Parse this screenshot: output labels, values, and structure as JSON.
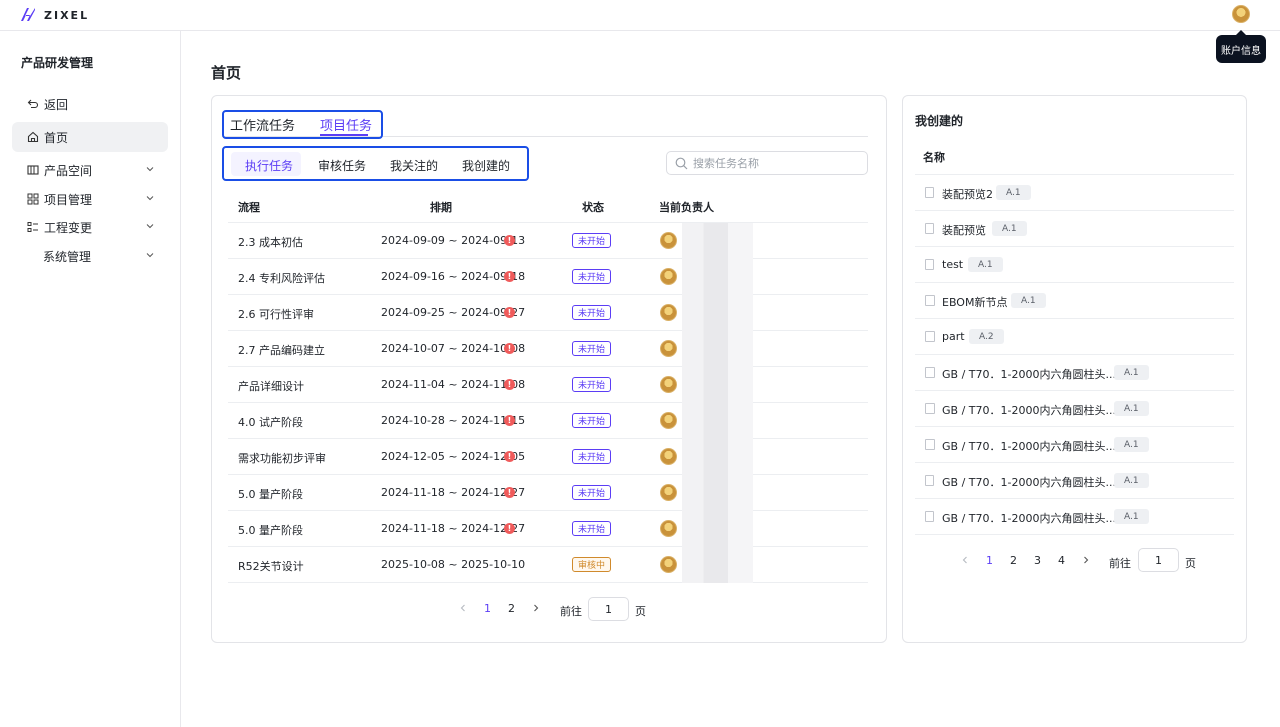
{
  "brand": {
    "name": "ZIXEL"
  },
  "account": {
    "tooltip": "账户信息"
  },
  "sidebar": {
    "title": "产品研发管理",
    "items": [
      {
        "label": "返回",
        "icon": "back-icon"
      },
      {
        "label": "首页",
        "icon": "home-icon",
        "active": true
      },
      {
        "label": "产品空间",
        "icon": "product-space-icon"
      },
      {
        "label": "项目管理",
        "icon": "project-grid-icon"
      },
      {
        "label": "工程变更",
        "icon": "change-list-icon"
      },
      {
        "label": "系统管理",
        "icon": ""
      }
    ]
  },
  "page": {
    "title": "首页"
  },
  "main": {
    "tabs": [
      "工作流任务",
      "项目任务"
    ],
    "active_tab": "项目任务",
    "subtabs": [
      "执行任务",
      "审核任务",
      "我关注的",
      "我创建的"
    ],
    "active_subtab": "执行任务",
    "search": {
      "placeholder": "搜索任务名称",
      "value": ""
    },
    "table": {
      "headers": [
        "流程",
        "排期",
        "状态",
        "当前负责人"
      ],
      "rows": [
        {
          "name": "2.3 成本初估",
          "schedule": "2024-09-09 ~ 2024-09-13",
          "overdue": true,
          "status": "未开始"
        },
        {
          "name": "2.4 专利风险评估",
          "schedule": "2024-09-16 ~ 2024-09-18",
          "overdue": true,
          "status": "未开始"
        },
        {
          "name": "2.6 可行性评审",
          "schedule": "2024-09-25 ~ 2024-09-27",
          "overdue": true,
          "status": "未开始"
        },
        {
          "name": "2.7 产品编码建立",
          "schedule": "2024-10-07 ~ 2024-10-08",
          "overdue": true,
          "status": "未开始"
        },
        {
          "name": "产品详细设计",
          "schedule": "2024-11-04 ~ 2024-11-08",
          "overdue": true,
          "status": "未开始"
        },
        {
          "name": "4.0 试产阶段",
          "schedule": "2024-10-28 ~ 2024-11-15",
          "overdue": true,
          "status": "未开始"
        },
        {
          "name": "需求功能初步评审",
          "schedule": "2024-12-05 ~ 2024-12-05",
          "overdue": true,
          "status": "未开始"
        },
        {
          "name": "5.0 量产阶段",
          "schedule": "2024-11-18 ~ 2024-12-27",
          "overdue": true,
          "status": "未开始"
        },
        {
          "name": "5.0 量产阶段",
          "schedule": "2024-11-18 ~ 2024-12-27",
          "overdue": true,
          "status": "未开始"
        },
        {
          "name": "R52关节设计",
          "schedule": "2025-10-08 ~ 2025-10-10",
          "overdue": false,
          "status": "审核中"
        }
      ]
    },
    "pagination": {
      "pages": [
        "1",
        "2"
      ],
      "current": "1",
      "goto_label": "前往",
      "goto_value": "1",
      "page_suffix": "页"
    }
  },
  "created": {
    "title": "我创建的",
    "header": "名称",
    "items": [
      {
        "name": "装配预览2",
        "version": "A.1",
        "kind": "doc"
      },
      {
        "name": "装配预览",
        "version": "A.1",
        "kind": "doc"
      },
      {
        "name": "test",
        "version": "A.1",
        "kind": "doc"
      },
      {
        "name": "EBOM新节点",
        "version": "A.1",
        "kind": "part"
      },
      {
        "name": "part",
        "version": "A.2",
        "kind": "part"
      },
      {
        "name": "GB / T70．1-2000内六角圆柱头...",
        "version": "A.1",
        "kind": "part"
      },
      {
        "name": "GB / T70．1-2000内六角圆柱头...",
        "version": "A.1",
        "kind": "part"
      },
      {
        "name": "GB / T70．1-2000内六角圆柱头...",
        "version": "A.1",
        "kind": "part"
      },
      {
        "name": "GB / T70．1-2000内六角圆柱头...",
        "version": "A.1",
        "kind": "doc"
      },
      {
        "name": "GB / T70．1-2000内六角圆柱头...",
        "version": "A.1",
        "kind": "doc"
      }
    ],
    "pagination": {
      "pages": [
        "1",
        "2",
        "3",
        "4"
      ],
      "current": "1",
      "goto_label": "前往",
      "goto_value": "1",
      "page_suffix": "页"
    }
  },
  "colors": {
    "accent": "#5b3df5",
    "highlight_box": "#1a4ee6",
    "overdue": "#ef5b5b",
    "review": "#d08a2c"
  }
}
